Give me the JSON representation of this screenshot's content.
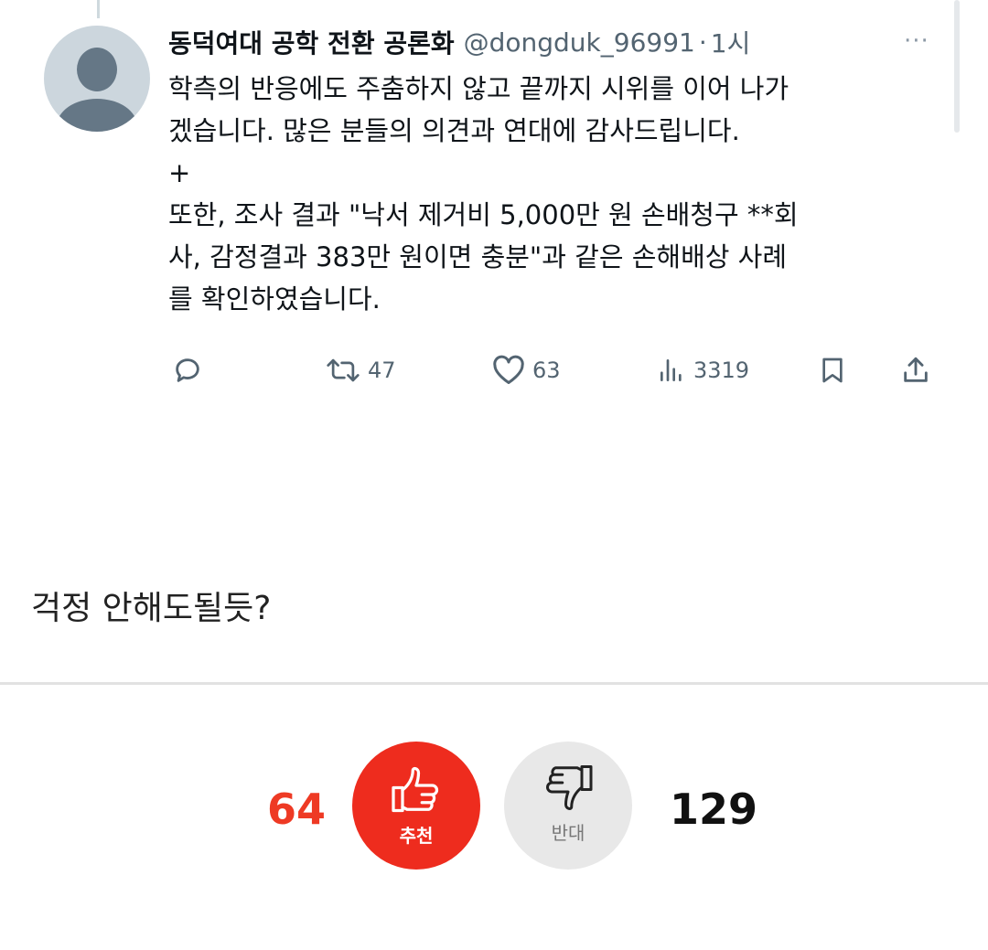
{
  "tweet": {
    "display_name": "동덕여대 공학 전환 공론화",
    "handle": "@dongduk_96991",
    "separator": "·",
    "time": "1시",
    "more": "···",
    "lines": [
      "학측의 반응에도 주춤하지 않고 끝까지 시위를 이어 나가",
      "겠습니다. 많은 분들의 의견과 연대에 감사드립니다.",
      "+",
      "또한, 조사 결과 \"낙서 제거비 5,000만 원 손배청구 **회",
      "사, 감정결과 383만 원이면 충분\"과 같은 손해배상 사례",
      "를 확인하였습니다."
    ],
    "actions": {
      "reply_icon": "reply-icon",
      "retweet_icon": "retweet-icon",
      "retweets": "47",
      "like_icon": "heart-icon",
      "likes": "63",
      "views_icon": "views-icon",
      "views": "3319",
      "bookmark_icon": "bookmark-icon",
      "share_icon": "share-icon"
    }
  },
  "comment": {
    "text": "걱정 안해도될듯?"
  },
  "votes": {
    "up_count": "64",
    "up_label": "추천",
    "up_icon": "thumbs-up-icon",
    "down_label": "반대",
    "down_icon": "thumbs-down-icon",
    "down_count": "129"
  },
  "colors": {
    "up_bg": "#ee2c1e",
    "up_count": "#ee3a24",
    "down_bg": "#e8e8e8",
    "muted": "#536471"
  }
}
